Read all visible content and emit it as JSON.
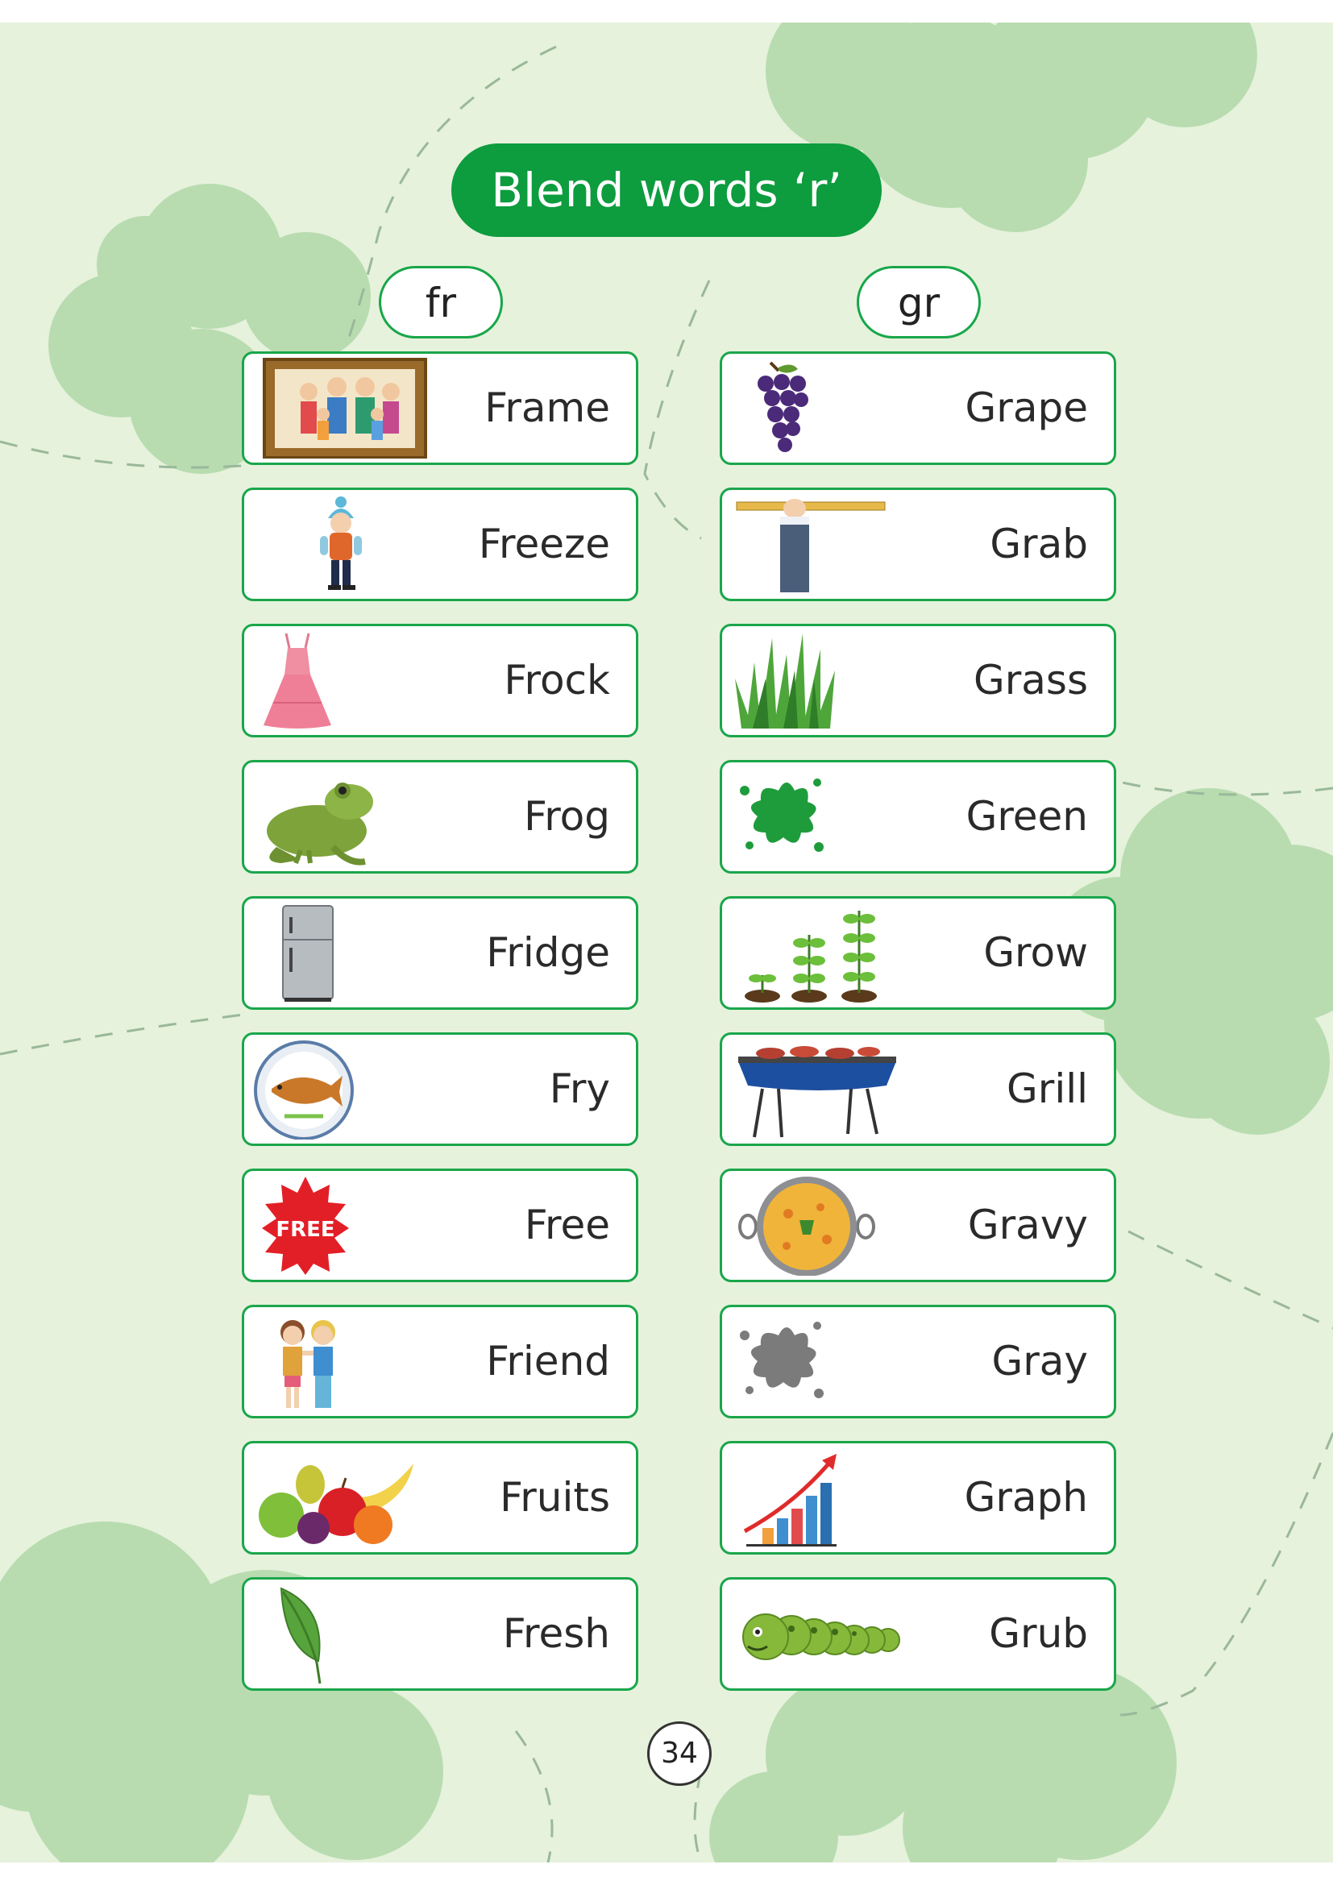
{
  "title": "Blend words ‘r’",
  "columns": [
    {
      "heading": "fr",
      "words": [
        {
          "word": "Frame",
          "icon": "family-frame-icon"
        },
        {
          "word": "Freeze",
          "icon": "cold-boy-icon"
        },
        {
          "word": "Frock",
          "icon": "pink-dress-icon"
        },
        {
          "word": "Frog",
          "icon": "frog-icon"
        },
        {
          "word": "Fridge",
          "icon": "fridge-icon"
        },
        {
          "word": "Fry",
          "icon": "fried-fish-plate-icon"
        },
        {
          "word": "Free",
          "icon": "free-badge-icon",
          "badge_text": "FREE"
        },
        {
          "word": "Friend",
          "icon": "two-friends-icon"
        },
        {
          "word": "Fruits",
          "icon": "fruits-icon"
        },
        {
          "word": "Fresh",
          "icon": "leaf-icon"
        }
      ]
    },
    {
      "heading": "gr",
      "words": [
        {
          "word": "Grape",
          "icon": "grapes-icon"
        },
        {
          "word": "Grab",
          "icon": "hand-grab-bar-icon"
        },
        {
          "word": "Grass",
          "icon": "grass-icon"
        },
        {
          "word": "Green",
          "icon": "green-splash-icon"
        },
        {
          "word": "Grow",
          "icon": "growing-plants-icon"
        },
        {
          "word": "Grill",
          "icon": "bbq-grill-icon"
        },
        {
          "word": "Gravy",
          "icon": "gravy-bowl-icon"
        },
        {
          "word": "Gray",
          "icon": "gray-splash-icon"
        },
        {
          "word": "Graph",
          "icon": "bar-graph-icon"
        },
        {
          "word": "Grub",
          "icon": "caterpillar-icon"
        }
      ]
    }
  ],
  "page_number": "34",
  "colors": {
    "accent": "#0d9c3e",
    "card_border": "#1aa64b",
    "background": "#e6f2dc",
    "blob": "#b8dcb0"
  }
}
